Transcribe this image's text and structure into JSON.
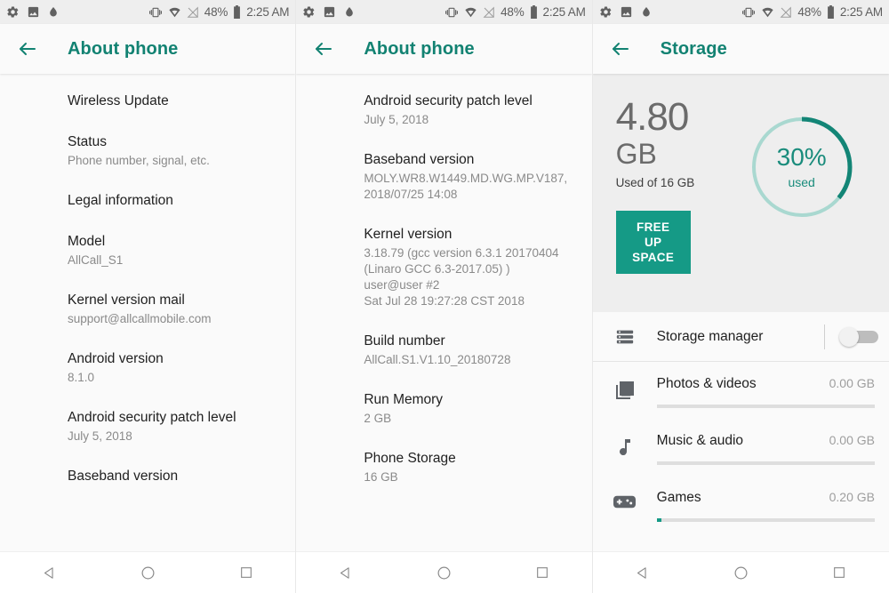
{
  "statusbar": {
    "battery_percent": "48%",
    "time": "2:25 AM",
    "icons": [
      "gear-icon",
      "image-icon",
      "droplet-icon",
      "vibrate-icon",
      "wifi-icon",
      "signal-off-icon",
      "battery-icon"
    ]
  },
  "navbar": {
    "back_label": "back-triangle-icon",
    "home_label": "home-circle-icon",
    "recents_label": "recents-square-icon"
  },
  "screens": [
    {
      "title": "About phone",
      "back_icon": "arrow-back-icon",
      "items": [
        {
          "title": "Wireless Update",
          "sub": ""
        },
        {
          "title": "Status",
          "sub": "Phone number, signal, etc."
        },
        {
          "title": "Legal information",
          "sub": ""
        },
        {
          "title": "Model",
          "sub": "AllCall_S1"
        },
        {
          "title": "Kernel version mail",
          "sub": "support@allcallmobile.com"
        },
        {
          "title": "Android version",
          "sub": "8.1.0"
        },
        {
          "title": "Android security patch level",
          "sub": "July 5, 2018"
        },
        {
          "title": "Baseband version",
          "sub": ""
        }
      ]
    },
    {
      "title": "About phone",
      "back_icon": "arrow-back-icon",
      "items": [
        {
          "title": "Android security patch level",
          "sub": "July 5, 2018"
        },
        {
          "title": "Baseband version",
          "sub": "MOLY.WR8.W1449.MD.WG.MP.V187, 2018/07/25 14:08"
        },
        {
          "title": "Kernel version",
          "sub": "3.18.79 (gcc version 6.3.1 20170404 (Linaro GCC 6.3-2017.05) )\nuser@user #2\nSat Jul 28 19:27:28 CST 2018"
        },
        {
          "title": "Build number",
          "sub": "AllCall.S1.V1.10_20180728"
        },
        {
          "title": "Run Memory",
          "sub": "2 GB"
        },
        {
          "title": "Phone Storage",
          "sub": "16 GB"
        }
      ]
    },
    {
      "title": "Storage",
      "back_icon": "arrow-back-icon",
      "summary": {
        "amount": "4.80",
        "unit": "GB",
        "used_of": "Used of 16 GB",
        "free_button": "FREE UP SPACE",
        "gauge_percent": "30%",
        "gauge_caption": "used",
        "gauge_value": 30
      },
      "manager": {
        "label": "Storage manager",
        "icon": "storage-manager-icon",
        "toggle_on": false
      },
      "categories": [
        {
          "name": "Photos & videos",
          "size": "0.00 GB",
          "fill_percent": 0,
          "icon": "photos-icon"
        },
        {
          "name": "Music & audio",
          "size": "0.00 GB",
          "fill_percent": 0,
          "icon": "music-note-icon"
        },
        {
          "name": "Games",
          "size": "0.20 GB",
          "fill_percent": 2,
          "icon": "games-controller-icon"
        }
      ]
    }
  ],
  "colors": {
    "accent": "#159a86",
    "title": "#128272",
    "gauge_track": "#a9d8d0",
    "status_bg": "#eeeeee",
    "page_bg": "#fafafa"
  }
}
